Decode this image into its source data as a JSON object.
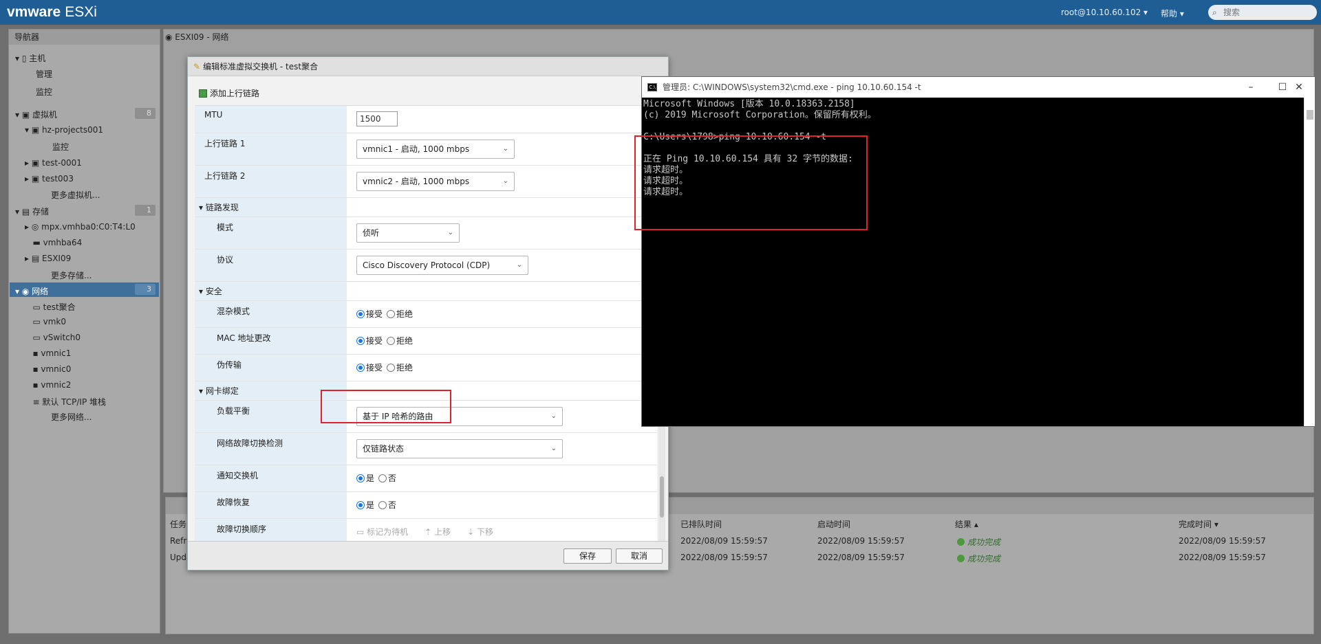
{
  "topbar": {
    "brand_vm": "vmware",
    "brand_product": "ESXi",
    "user": "root@10.10.60.102 ▾",
    "help": "帮助 ▾",
    "search_placeholder": "搜索"
  },
  "navigator": {
    "title": "导航器",
    "items": [
      {
        "label": "主机"
      },
      {
        "label": "管理"
      },
      {
        "label": "监控"
      },
      {
        "label": "虚拟机",
        "badge": "8"
      },
      {
        "label": "hz-projects001"
      },
      {
        "label": "监控"
      },
      {
        "label": "test-0001"
      },
      {
        "label": "test003"
      },
      {
        "label": "更多虚拟机..."
      },
      {
        "label": "存储",
        "badge": "1"
      },
      {
        "label": "mpx.vmhba0:C0:T4:L0"
      },
      {
        "label": "vmhba64"
      },
      {
        "label": "ESXI09"
      },
      {
        "label": "更多存储..."
      },
      {
        "label": "网络",
        "badge": "3"
      },
      {
        "label": "test聚合"
      },
      {
        "label": "vmk0"
      },
      {
        "label": "vSwitch0"
      },
      {
        "label": "vmnic1"
      },
      {
        "label": "vmnic0"
      },
      {
        "label": "vmnic2"
      },
      {
        "label": "默认 TCP/IP 堆栈"
      },
      {
        "label": "更多网络..."
      }
    ]
  },
  "main": {
    "title": "ESXI09 - 网络"
  },
  "tasks": {
    "columns": [
      "任务",
      "已排队时间",
      "启动时间",
      "结果 ▴",
      "完成时间 ▾"
    ],
    "rows": [
      {
        "task": "Refre",
        "queued": "2022/08/09 15:59:57",
        "started": "2022/08/09 15:59:57",
        "result": "成功完成",
        "completed": "2022/08/09 15:59:57"
      },
      {
        "task": "Upda",
        "queued": "2022/08/09 15:59:57",
        "started": "2022/08/09 15:59:57",
        "result": "成功完成",
        "completed": "2022/08/09 15:59:57"
      }
    ]
  },
  "dialog": {
    "title": "编辑标准虚拟交换机 - test聚合",
    "add_uplink": "添加上行链路",
    "mtu": {
      "label": "MTU",
      "value": "1500"
    },
    "uplink1": {
      "label": "上行链路 1",
      "value": "vmnic1 - 启动, 1000 mbps"
    },
    "uplink2": {
      "label": "上行链路 2",
      "value": "vmnic2 - 启动, 1000 mbps"
    },
    "link_discovery": {
      "label": "链路发现",
      "mode_label": "模式",
      "mode_value": "侦听",
      "protocol_label": "协议",
      "protocol_value": "Cisco Discovery Protocol (CDP)"
    },
    "security": {
      "label": "安全",
      "promiscuous": "混杂模式",
      "mac_changes": "MAC 地址更改",
      "forged": "伪传输",
      "accept": "接受",
      "reject": "拒绝"
    },
    "nic_teaming": {
      "label": "网卡绑定",
      "load_balance_label": "负载平衡",
      "load_balance_value": "基于 IP 哈希的路由",
      "failover_detect_label": "网络故障切换检测",
      "failover_detect_value": "仅链路状态",
      "notify_label": "通知交换机",
      "failback_label": "故障恢复",
      "yes": "是",
      "no": "否",
      "order_label": "故障切换顺序",
      "mark_standby": "标记为待机",
      "move_up": "上移",
      "move_down": "下移"
    },
    "save": "保存",
    "cancel": "取消"
  },
  "cmd": {
    "title": "管理员: C:\\WINDOWS\\system32\\cmd.exe - ping  10.10.60.154 -t",
    "lines": [
      "Microsoft Windows [版本 10.0.18363.2158]",
      "(c) 2019 Microsoft Corporation。保留所有权利。",
      "",
      "C:\\Users\\1798>ping 10.10.60.154 -t",
      "",
      "正在 Ping 10.10.60.154 具有 32 字节的数据:",
      "请求超时。",
      "请求超时。",
      "请求超时。"
    ]
  },
  "colors": {
    "topbar": "#1e5e94",
    "highlight": "#e0202a",
    "selection": "#3f6f9b"
  }
}
